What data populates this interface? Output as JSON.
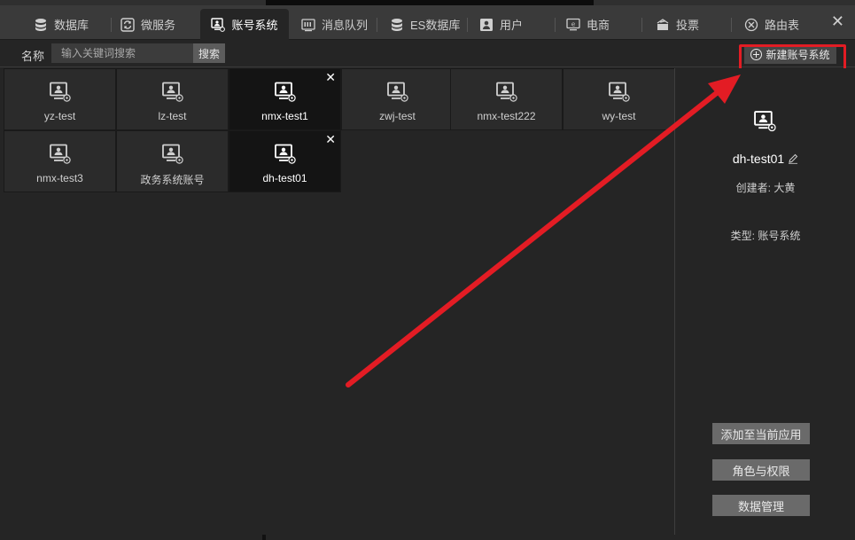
{
  "tabs": [
    {
      "label": "数据库",
      "icon": "database-icon"
    },
    {
      "label": "微服务",
      "icon": "refresh-service-icon"
    },
    {
      "label": "账号系统",
      "icon": "account-system-icon",
      "active": true
    },
    {
      "label": "消息队列",
      "icon": "message-queue-icon"
    },
    {
      "label": "ES数据库",
      "icon": "es-database-icon"
    },
    {
      "label": "用户",
      "icon": "user-icon"
    },
    {
      "label": "电商",
      "icon": "ecommerce-icon"
    },
    {
      "label": "投票",
      "icon": "vote-icon"
    },
    {
      "label": "路由表",
      "icon": "route-table-icon"
    }
  ],
  "toolbar": {
    "name_label": "名称",
    "search_placeholder": "输入关键词搜索",
    "search_button": "搜索",
    "new_button": "新建账号系统"
  },
  "accounts": [
    {
      "name": "yz-test"
    },
    {
      "name": "lz-test"
    },
    {
      "name": "nmx-test1",
      "selected": true
    },
    {
      "name": "zwj-test"
    },
    {
      "name": "nmx-test222"
    },
    {
      "name": "wy-test"
    },
    {
      "name": "nmx-test3"
    },
    {
      "name": "政务系统账号"
    },
    {
      "name": "dh-test01",
      "selected": true
    }
  ],
  "detail": {
    "title": "dh-test01",
    "creator": "创建者: 大黄",
    "type": "类型:  账号系统",
    "add_button": "添加至当前应用",
    "roles_button": "角色与权限",
    "data_button": "数据管理"
  },
  "colors": {
    "annotation_red": "#e31c24",
    "background": "#252525",
    "tab_bar": "#3a3a3a"
  }
}
